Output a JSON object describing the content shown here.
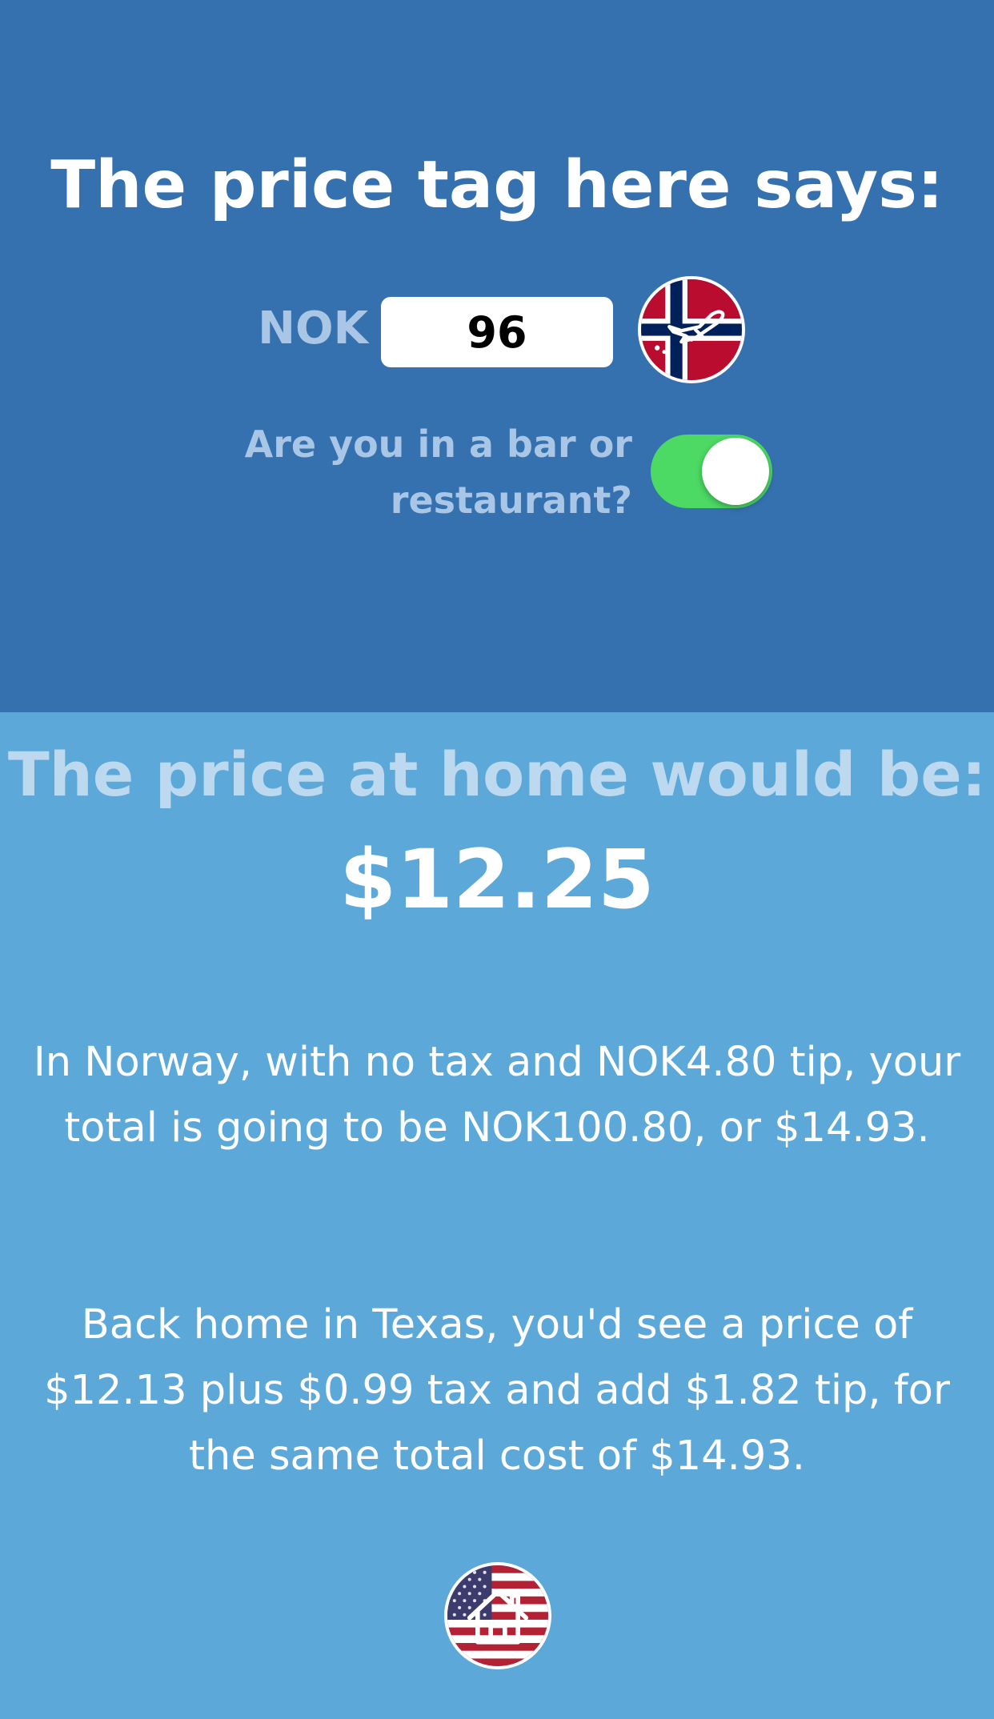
{
  "foreign": {
    "title": "The price tag here says:",
    "currency_code": "NOK",
    "price_value": "96",
    "flag_icon": "norway-flag-airplane-icon",
    "toggle_question": "Are you in a bar or restaurant?",
    "toggle_on": true
  },
  "home": {
    "title": "The price at home would be:",
    "price": "$12.25",
    "norway_summary": "In Norway, with no tax and NOK4.80 tip, your total is going to be NOK100.80, or $14.93.",
    "home_summary": "Back home in Texas, you'd see a price of $12.13 plus $0.99 tax and add $1.82 tip, for the same total cost of $14.93.",
    "home_icon": "usa-flag-house-icon"
  },
  "colors": {
    "top_background": "#3571ae",
    "bottom_background": "#5ba8d9",
    "muted_text": "#a9c6e6",
    "toggle_on": "#4cd964"
  }
}
